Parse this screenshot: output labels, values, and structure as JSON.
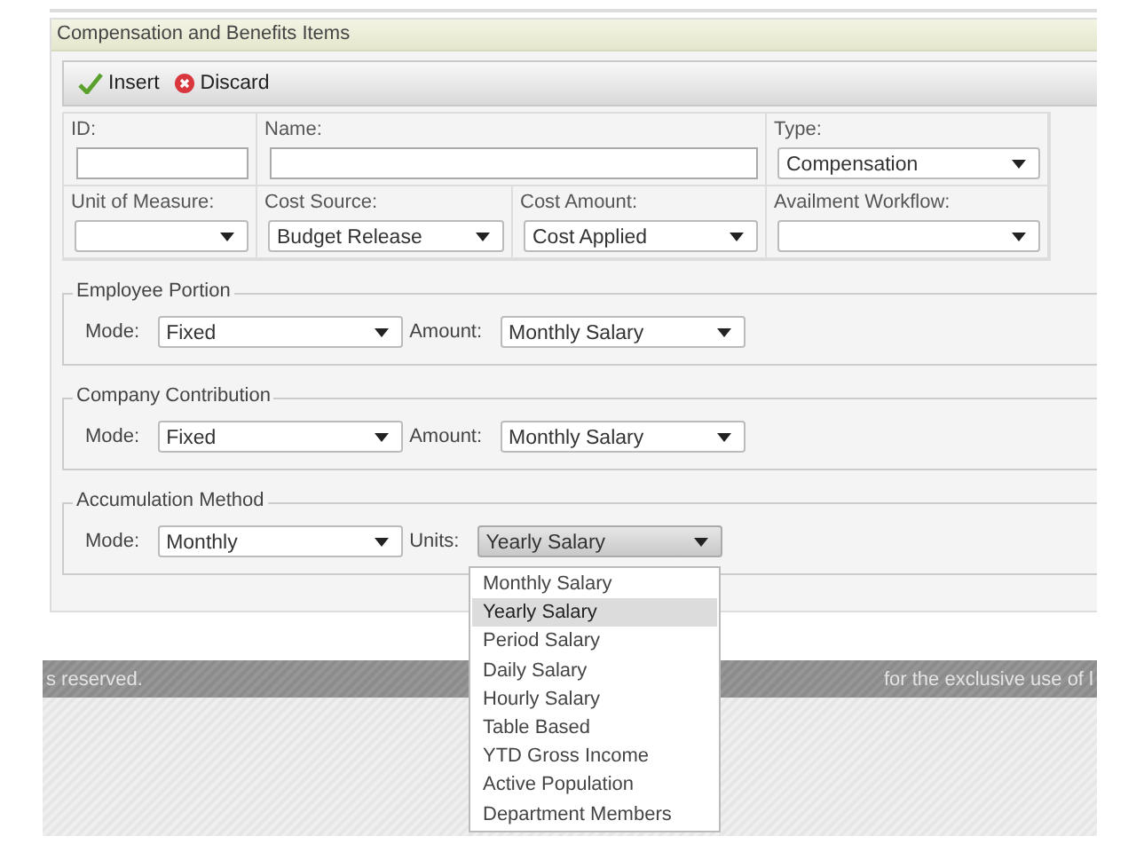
{
  "panel": {
    "title": "Compensation and Benefits Items"
  },
  "toolbar": [
    {
      "label": "Insert",
      "kind": "insert"
    },
    {
      "label": "Discard",
      "kind": "discard"
    }
  ],
  "form_rows": [
    [
      {
        "label": "ID:",
        "kind": "text"
      },
      {
        "label": "Name:",
        "kind": "text"
      },
      {
        "label": "Type:",
        "kind": "select",
        "value": "Compensation"
      }
    ],
    [
      {
        "label": "Unit of Measure:",
        "kind": "select"
      },
      {
        "label": "Cost Source:",
        "kind": "select",
        "value": "Budget Release"
      },
      {
        "label": "Cost Amount:",
        "kind": "select",
        "value": "Cost Applied"
      },
      {
        "label": "Availment Workflow:",
        "kind": "select"
      }
    ]
  ],
  "groups": [
    {
      "legend": "Employee Portion",
      "fields": [
        {
          "label": "Mode:",
          "value": "Fixed",
          "expanded": false
        },
        {
          "label": "Amount:",
          "value": "Monthly Salary",
          "expanded": false
        }
      ]
    },
    {
      "legend": "Company Contribution",
      "fields": [
        {
          "label": "Mode:",
          "value": "Fixed",
          "expanded": false
        },
        {
          "label": "Amount:",
          "value": "Monthly Salary",
          "expanded": false
        }
      ]
    },
    {
      "legend": "Accumulation Method",
      "fields": [
        {
          "label": "Mode:",
          "value": "Monthly",
          "expanded": false
        },
        {
          "label": "Units:",
          "value": "Yearly Salary",
          "expanded": true
        }
      ]
    }
  ],
  "dropdown_options": [
    {
      "label": "Monthly Salary",
      "selected": false
    },
    {
      "label": "Yearly Salary",
      "selected": true
    },
    {
      "label": "Period Salary",
      "selected": false
    },
    {
      "label": "Daily Salary",
      "selected": false
    },
    {
      "label": "Hourly Salary",
      "selected": false
    },
    {
      "label": "Table Based",
      "selected": false
    },
    {
      "label": "YTD Gross Income",
      "selected": false
    },
    {
      "label": "Active Population",
      "selected": false
    },
    {
      "label": "Department Members",
      "selected": false
    }
  ],
  "footer": {
    "left": "s reserved.",
    "right": "for the exclusive use of l"
  }
}
